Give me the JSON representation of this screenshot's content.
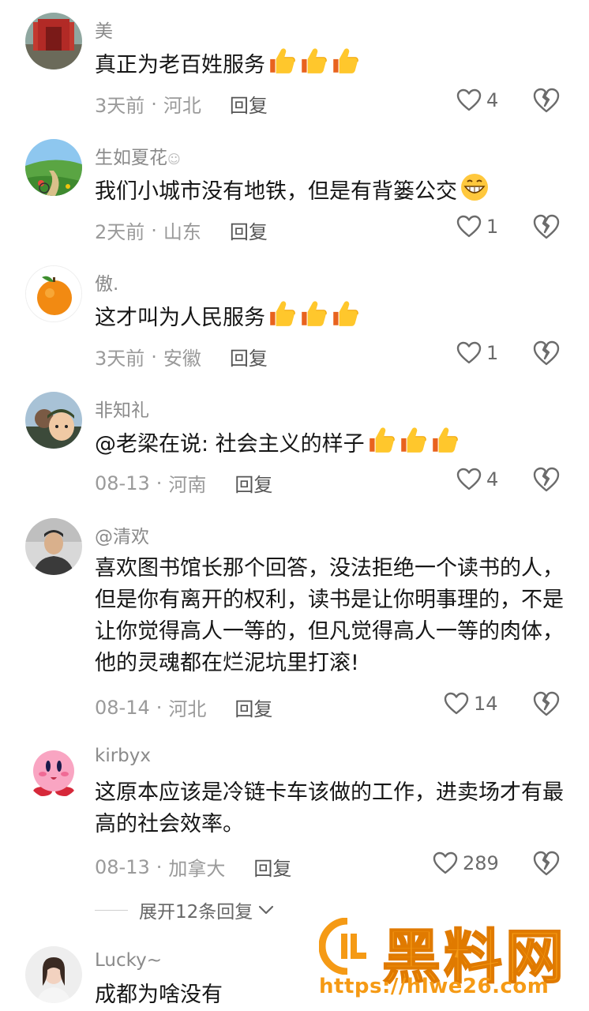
{
  "comments": [
    {
      "username": "美",
      "text": "真正为老百姓服务",
      "emoji": "thumbs-up x3",
      "time": "3天前",
      "location": "河北",
      "reply": "回复",
      "likes": "4"
    },
    {
      "username": "生如夏花",
      "text": "我们小城市没有地铁，但是有背篓公交",
      "emoji": "grinning-face",
      "time": "2天前",
      "location": "山东",
      "reply": "回复",
      "likes": "1"
    },
    {
      "username": "傲.",
      "text": "这才叫为人民服务",
      "emoji": "thumbs-up x3",
      "time": "3天前",
      "location": "安徽",
      "reply": "回复",
      "likes": "1"
    },
    {
      "username": "非知礼",
      "text": "@老梁在说: 社会主义的样子",
      "emoji": "thumbs-up x3",
      "time": "08-13",
      "location": "河南",
      "reply": "回复",
      "likes": "4"
    },
    {
      "username": "@清欢",
      "text": "喜欢图书馆长那个回答，没法拒绝一个读书的人，但是你有离开的权利，读书是让你明事理的，不是让你觉得高人一等的，但凡觉得高人一等的肉体，他的灵魂都在烂泥坑里打滚!",
      "time": "08-14",
      "location": "河北",
      "reply": "回复",
      "likes": "14"
    },
    {
      "username": "kirbyx",
      "text": "这原本应该是冷链卡车该做的工作，进卖场才有最高的社会效率。",
      "time": "08-13",
      "location": "加拿大",
      "reply": "回复",
      "likes": "289"
    },
    {
      "username": "Lucky~",
      "text": "成都为啥没有"
    }
  ],
  "expand_replies": "展开12条回复",
  "watermark": {
    "title": "黑料网",
    "url": "https://hlwe26.com"
  },
  "colors": {
    "muted": "#9a9a9a",
    "text": "#161616",
    "watermark": "#f59a15"
  }
}
